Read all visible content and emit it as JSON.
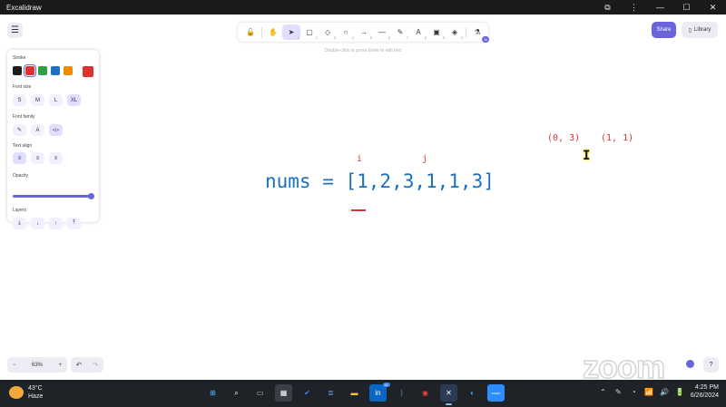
{
  "window": {
    "title": "Excalidraw",
    "controls": [
      "⧉",
      "⋮",
      "—",
      "☐",
      "✕"
    ]
  },
  "toolbar": {
    "tools": [
      {
        "name": "lock-tool",
        "glyph": "🔓",
        "key": ""
      },
      {
        "name": "hand-tool",
        "glyph": "✋",
        "key": ""
      },
      {
        "name": "selection-tool",
        "glyph": "➤",
        "key": "1",
        "active": true
      },
      {
        "name": "rectangle-tool",
        "glyph": "▢",
        "key": "2"
      },
      {
        "name": "diamond-tool",
        "glyph": "◇",
        "key": "3"
      },
      {
        "name": "ellipse-tool",
        "glyph": "○",
        "key": "4"
      },
      {
        "name": "arrow-tool",
        "glyph": "→",
        "key": "5"
      },
      {
        "name": "line-tool",
        "glyph": "—",
        "key": "6"
      },
      {
        "name": "draw-tool",
        "glyph": "✎",
        "key": "7"
      },
      {
        "name": "text-tool",
        "glyph": "A",
        "key": "8"
      },
      {
        "name": "image-tool",
        "glyph": "▣",
        "key": "9"
      },
      {
        "name": "eraser-tool",
        "glyph": "◈",
        "key": "0"
      },
      {
        "name": "more-tools",
        "glyph": "⚗",
        "key": "",
        "badge": "AI"
      }
    ]
  },
  "hint": "Double-click or press Enter to edit text",
  "header": {
    "share_label": "Share",
    "library_label": "Library"
  },
  "panel": {
    "stroke_label": "Stroke",
    "stroke_colors": [
      "#1e1e1e",
      "#e03131",
      "#2f9e44",
      "#1971c2",
      "#f08c00"
    ],
    "selected_stroke": "#e03131",
    "current_color": "#e03131",
    "font_size_label": "Font size",
    "font_sizes": [
      "S",
      "M",
      "L",
      "XL"
    ],
    "selected_font_size": "XL",
    "font_family_label": "Font family",
    "font_families": [
      {
        "name": "hand-drawn-font-button",
        "glyph": "✎"
      },
      {
        "name": "normal-font-button",
        "glyph": "A"
      },
      {
        "name": "code-font-button",
        "glyph": "</>",
        "active": true
      }
    ],
    "text_align_label": "Text align",
    "text_aligns": [
      {
        "name": "align-left-button",
        "glyph": "≡",
        "active": true
      },
      {
        "name": "align-center-button",
        "glyph": "≡"
      },
      {
        "name": "align-right-button",
        "glyph": "≡"
      }
    ],
    "opacity_label": "Opacity",
    "opacity_value": 100,
    "layers_label": "Layers",
    "layers": [
      {
        "name": "send-to-back-button",
        "glyph": "⤓"
      },
      {
        "name": "send-backward-button",
        "glyph": "↓"
      },
      {
        "name": "bring-forward-button",
        "glyph": "↑"
      },
      {
        "name": "bring-to-front-button",
        "glyph": "⤒"
      }
    ]
  },
  "canvas": {
    "nums_text": "nums = [1,2,3,1,1,3]",
    "pointer_i": "i",
    "pointer_j": "j",
    "coord_left": "(0, 3)",
    "coord_right": "(1, 1)",
    "cursor_glyph": "I",
    "text_color": "#1971c2",
    "annotation_color": "#e03131"
  },
  "bottom": {
    "zoom_out": "−",
    "zoom_level": "63%",
    "zoom_in": "+",
    "undo": "↶",
    "redo": "↷",
    "help": "?",
    "watermark": "zoom"
  },
  "taskbar": {
    "temperature": "43°C",
    "condition": "Haze",
    "apps": [
      {
        "name": "start-button",
        "glyph": "⊞",
        "bg": "#1f2227",
        "color": "#4cc2ff"
      },
      {
        "name": "search-button",
        "glyph": "⌕",
        "bg": "#1f2227",
        "color": "#ffffff"
      },
      {
        "name": "task-view-button",
        "glyph": "▭",
        "bg": "#1f2227",
        "color": "#cccccc"
      },
      {
        "name": "store-app",
        "glyph": "▦",
        "bg": "#3a3f47",
        "color": "#ffffff"
      },
      {
        "name": "todo-app",
        "glyph": "✔",
        "bg": "#1f2227",
        "color": "#3b82f6"
      },
      {
        "name": "notepad-app",
        "glyph": "≣",
        "bg": "#1f2227",
        "color": "#7fb3ff"
      },
      {
        "name": "file-explorer-app",
        "glyph": "▬",
        "bg": "#1f2227",
        "color": "#f6c445"
      },
      {
        "name": "linkedin-app",
        "glyph": "in",
        "bg": "#0a66c2",
        "color": "#ffffff",
        "count": "41"
      },
      {
        "name": "vscode-app",
        "glyph": "⟩",
        "bg": "#1f2227",
        "color": "#3ca0f0"
      },
      {
        "name": "chrome-app",
        "glyph": "◉",
        "bg": "#1f2227",
        "color": "#e8453c"
      },
      {
        "name": "excalidraw-app",
        "glyph": "✕",
        "bg": "#2b3a55",
        "color": "#ffffff",
        "active": true
      },
      {
        "name": "edge-app",
        "glyph": "◐",
        "bg": "#1f2227",
        "color": "#2fb8d6"
      },
      {
        "name": "zoom-app",
        "glyph": "zoom",
        "bg": "#2d8cff",
        "color": "#ffffff"
      }
    ],
    "tray_icons": [
      "⌃",
      "✎",
      "◔",
      "📶",
      "🔊",
      "🔋"
    ],
    "time": "4:25 PM",
    "date": "6/26/2024"
  }
}
